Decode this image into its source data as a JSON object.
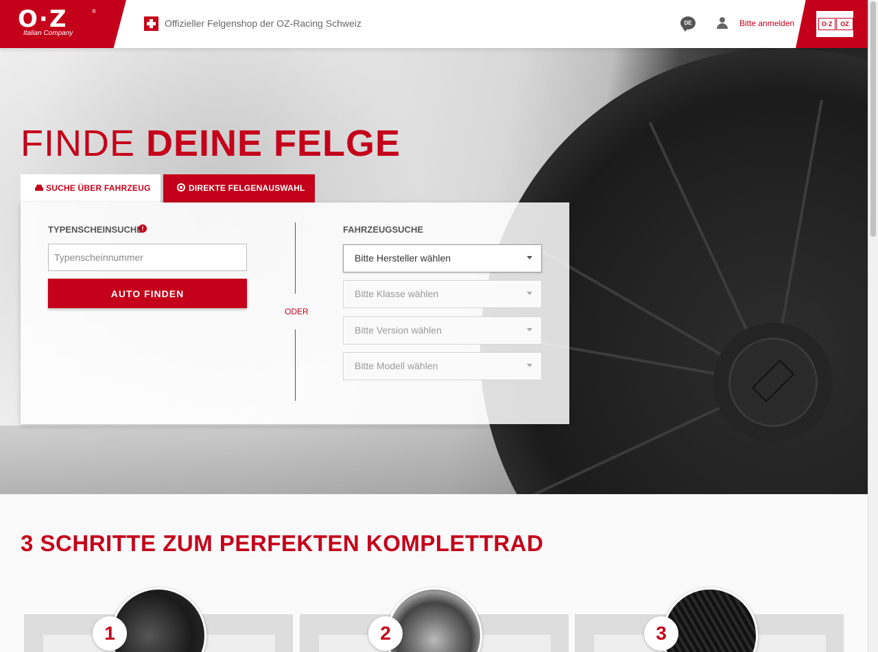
{
  "header": {
    "logo_text": "O·Z",
    "logo_registered": "®",
    "logo_subtitle": "Italian Company",
    "shop_title": "Offizieller Felgenshop der OZ-Racing Schweiz",
    "language": "DE",
    "login_label": "Bitte anmelden",
    "brand_badge_left": "O·Z",
    "brand_badge_right": "OZ"
  },
  "hero": {
    "title_light": "FINDE ",
    "title_bold": "DEINE FELGE"
  },
  "tabs": [
    {
      "label": "SUCHE ÜBER FAHRZEUG",
      "icon": "car-icon",
      "active": false
    },
    {
      "label": "DIREKTE FELGENAUSWAHL",
      "icon": "target-icon",
      "active": true
    }
  ],
  "search": {
    "type_label": "TYPENSCHEINSUCHE",
    "info_icon_symbol": "!",
    "type_placeholder": "Typenscheinnummer",
    "type_value": "",
    "find_button": "AUTO FINDEN",
    "or_label": "ODER",
    "vehicle_label": "FAHRZEUGSUCHE",
    "selects": [
      {
        "value": "Bitte Hersteller wählen",
        "enabled": true
      },
      {
        "value": "Bitte Klasse wählen",
        "enabled": false
      },
      {
        "value": "Bitte Version wählen",
        "enabled": false
      },
      {
        "value": "Bitte Modell wählen",
        "enabled": false
      }
    ]
  },
  "steps": {
    "title_bold": "3 SCHRITTE",
    "title_light": " ZUM PERFEKTEN KOMPLETTRAD",
    "items": [
      {
        "number": "1"
      },
      {
        "number": "2"
      },
      {
        "number": "3"
      }
    ]
  },
  "colors": {
    "accent": "#c4001a",
    "text": "#333333"
  }
}
